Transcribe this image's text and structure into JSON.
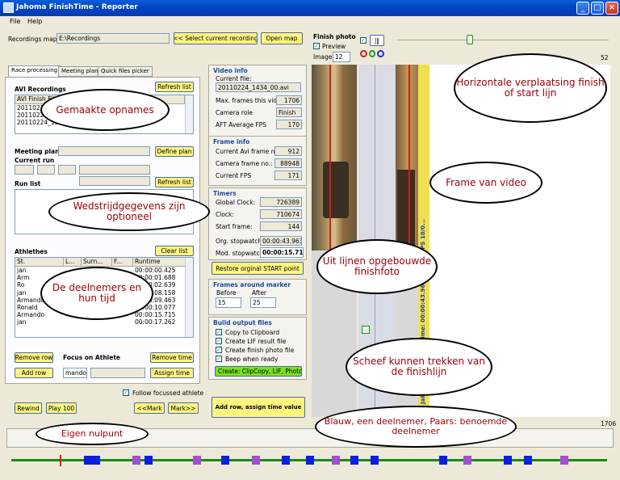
{
  "window": {
    "title": "Jahoma FinishTime - Reporter"
  },
  "menu": [
    "File",
    "Help"
  ],
  "top": {
    "recordings_label": "Recordings map:",
    "recordings_value": "E:\\Recordings",
    "select_button": "<< Select current recording",
    "open_map_button": "Open map"
  },
  "tabs": [
    "Race processing",
    "Meeting plan",
    "Quick files picker"
  ],
  "avi": {
    "title": "AVI Recordings",
    "refresh": "Refresh list",
    "header": "AVI Finish File",
    "rows": [
      "20110224_153",
      "20110224_152",
      "20110224_1526_29.8"
    ],
    "row_tail": "20100575..."
  },
  "meeting": {
    "plan_label": "Meeting plan",
    "define_button": "Define plan",
    "current_run": "Current run",
    "refresh": "Refresh list",
    "run_list": "Run list"
  },
  "athletes": {
    "title": "Athlethes",
    "clear": "Clear list",
    "columns": [
      "St.",
      "L...",
      "Surn...",
      "F...",
      "Runtime"
    ],
    "rows": [
      {
        "st": "jan",
        "rt": "00:00:00.425"
      },
      {
        "st": "Arm",
        "rt": "00:00:01.688"
      },
      {
        "st": "Ro",
        "rt": "00:00:02.639"
      },
      {
        "st": "jan",
        "rt": "00:00:08.158"
      },
      {
        "st": "Armando",
        "rt": "00:00:09.463"
      },
      {
        "st": "Ronald",
        "rt": "00:00:10.077"
      },
      {
        "st": "Armando",
        "rt": "00:00:15.715"
      },
      {
        "st": "jan",
        "rt": "00:00:17.262"
      }
    ],
    "remove_row": "Remove row",
    "focus_label": "Focus on Athlete",
    "remove_time": "Remove time",
    "add_row": "Add row",
    "focus_value": "mando",
    "assign_time": "Assign time",
    "follow_label": "Follow focussed athlete"
  },
  "bottom_buttons": {
    "rewind": "Rewind",
    "play": "Play 100",
    "mark_prev": "<<Mark",
    "mark_next": "Mark>>",
    "add_assign": "Add row, assign time value"
  },
  "video_info": {
    "title": "Video info",
    "current_file_label": "Current file:",
    "current_file": "20110224_1434_00.avi",
    "max_frames_label": "Max. frames this video",
    "max_frames": "1706",
    "camera_role_label": "Camera role",
    "camera_role": "Finish",
    "aft_fps_label": "AFT Average FPS",
    "aft_fps": "170"
  },
  "frame_info": {
    "title": "Frame info",
    "avi_frame_label": "Current Avi frame no.:",
    "avi_frame": "912",
    "camera_frame_label": "Camera frame no.:",
    "camera_frame": "88948",
    "fps_label": "Current FPS",
    "fps": "171"
  },
  "timers": {
    "title": "Timers",
    "global_label": "Global Clock:",
    "global": "726389",
    "clock_label": "Clock:",
    "clock": "710674",
    "start_label": "Start frame:",
    "start": "144",
    "org_label": "Org. stopwatch:",
    "org": "00:00:43.963",
    "mod_label": "Mod. stopwatch:",
    "mod": "00:00:15.715",
    "restore": "Restore orginal START point"
  },
  "frames_marker": {
    "title": "Frames around marker",
    "before_label": "Before",
    "after_label": "After",
    "before": "15",
    "after": "25"
  },
  "build": {
    "title": "Build output files",
    "options": [
      "Copy to Clipboard",
      "Create LIF result file",
      "Create finish photo file",
      "Beep when ready"
    ],
    "create_button": "Create: ClipCopy, LIF, Photo"
  },
  "finish_photo": {
    "title": "Finish photo",
    "preview": "Preview",
    "images_label": "Images",
    "images": "12",
    "slider_max": "52",
    "frame_overlay": "JaHoMa-Timing(c) CTime: 00:00:43.963 ms 171 FPS 10/0..."
  },
  "timeline": {
    "max": "1706"
  },
  "annotations": {
    "gemaakte": "Gemaakte opnames",
    "wedstrijd": "Wedstrijdgegevens zijn optioneel",
    "deelnemers": "De deelnemers en hun tijd",
    "horizontale": "Horizontale verplaatsing finish of start lijn",
    "frame": "Frame van video",
    "uitlijnen": "Uit lijnen opgebouwde finishfoto",
    "scheef": "Scheef kunnen trekken van de finishlijn",
    "blauw": "Blauw, een deelnemer, Paars: benoemde deelnemer",
    "nulpunt": "Eigen nulpunt"
  },
  "colors": {
    "titlebar": "#0346c5",
    "annotation_text": "#a0000a",
    "blue_marker": "#0a1fe0",
    "purple_marker": "#a050d0",
    "timeline_green": "#1a8a1a"
  }
}
